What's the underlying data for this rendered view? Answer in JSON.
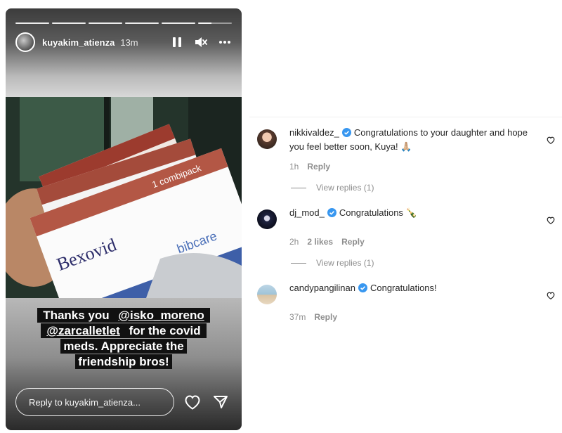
{
  "story": {
    "username": "kuyakim_atienza",
    "time": "13m",
    "progress_segments": 6,
    "caption_lines": [
      [
        {
          "text": "Thanks you "
        },
        {
          "text": "@isko_moreno",
          "mention": true
        }
      ],
      [
        {
          "text": "@zarcalletlet",
          "mention": true
        },
        {
          "text": " for the covid"
        }
      ],
      [
        {
          "text": "meds. Appreciate the"
        }
      ],
      [
        {
          "text": "friendship bros!"
        }
      ]
    ],
    "photo_text": {
      "brand": "Bexovid",
      "pack": "1 combipack",
      "maker": "bibcare"
    },
    "reply_placeholder": "Reply to kuyakim_atienza...",
    "icons": {
      "pause": "pause-icon",
      "mute": "mute-icon",
      "more": "more-icon",
      "like": "heart-icon",
      "share": "send-icon"
    }
  },
  "comments": [
    {
      "username": "nikkivaldez_",
      "verified": true,
      "text": "Congratulations to your daughter and hope you feel better soon, Kuya! 🙏🏼",
      "time": "1h",
      "likes": "",
      "reply_label": "Reply",
      "view_replies": "View replies (1)",
      "avatar_color": "#5a3b2e"
    },
    {
      "username": "dj_mod_",
      "verified": true,
      "text": "Congratulations 🍾",
      "time": "2h",
      "likes": "2 likes",
      "reply_label": "Reply",
      "view_replies": "View replies (1)",
      "avatar_color": "#1f2340"
    },
    {
      "username": "candypangilinan",
      "verified": true,
      "text": "Congratulations!",
      "time": "37m",
      "likes": "",
      "reply_label": "Reply",
      "view_replies": "",
      "avatar_color": "#9fc3d8"
    }
  ],
  "colors": {
    "verified": "#3897f0",
    "meta": "#8e8e8e",
    "text": "#262626"
  }
}
